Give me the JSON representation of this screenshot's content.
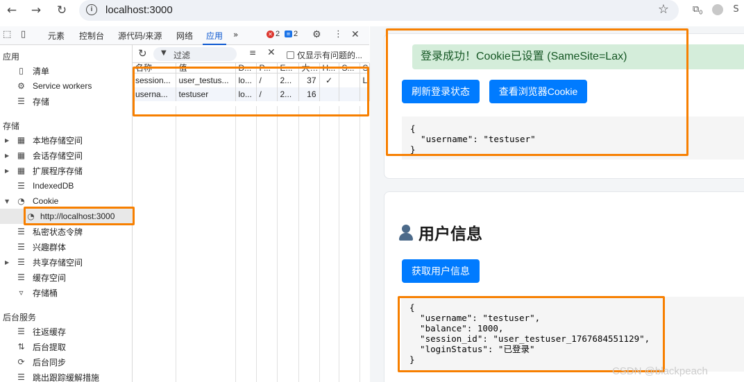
{
  "browser": {
    "url": "localhost:3000",
    "ext_badge": "0"
  },
  "devtools": {
    "tabs": [
      "元素",
      "控制台",
      "源代码/来源",
      "网络",
      "应用"
    ],
    "active_tab": "应用",
    "more_tabs": "»",
    "error_count": "2",
    "message_count": "2",
    "sidebar": {
      "app_header": "应用",
      "app_items": [
        "清单",
        "Service workers",
        "存储"
      ],
      "storage_header": "存储",
      "storage_items": [
        "本地存储空间",
        "会话存储空间",
        "扩展程序存储",
        "IndexedDB",
        "Cookie"
      ],
      "cookie_origin": "http://localhost:3000",
      "storage_items_after": [
        "私密状态令牌",
        "兴趣群体",
        "共享存储空间",
        "缓存空间",
        "存储桶"
      ],
      "bg_header": "后台服务",
      "bg_items": [
        "往返缓存",
        "后台提取",
        "后台同步",
        "跳出跟踪缓解措施"
      ]
    },
    "toolbar": {
      "filter_placeholder": "过滤",
      "only_issues_label": "仅显示有问题的..."
    },
    "cookie_table": {
      "headers": [
        "名称",
        "值",
        "D...",
        "P...",
        "E...",
        "大...",
        "H...",
        "S...",
        "S"
      ],
      "rows": [
        [
          "session...",
          "user_testus...",
          "lo...",
          "/",
          "2...",
          "37",
          "✓",
          "",
          "L"
        ],
        [
          "userna...",
          "testuser",
          "lo...",
          "/",
          "2...",
          "16",
          "",
          "",
          ""
        ]
      ]
    }
  },
  "page": {
    "success_message": "登录成功！Cookie已设置 (SameSite=Lax)",
    "refresh_button": "刷新登录状态",
    "view_cookie_button": "查看浏览器Cookie",
    "cookie_json": "{\n  \"username\": \"testuser\"\n}",
    "user_section_title": "用户信息",
    "get_user_button": "获取用户信息",
    "user_json": "{\n  \"username\": \"testuser\",\n  \"balance\": 1000,\n  \"session_id\": \"user_testuser_1767684551129\",\n  \"loginStatus\": \"已登录\"\n}"
  },
  "watermark": "CSDN @blackpeach",
  "colors": {
    "highlight": "#f77f00",
    "primary_button": "#007bff",
    "success_bg": "#d4edda",
    "success_text": "#155724",
    "devtools_active": "#0b57d0"
  }
}
